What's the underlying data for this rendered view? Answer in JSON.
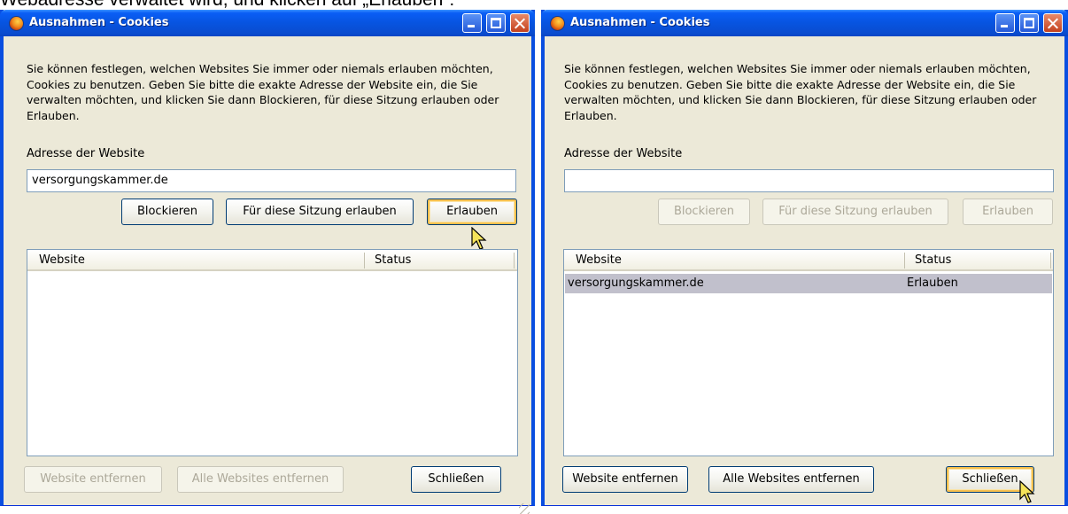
{
  "document": {
    "partial_text": "Webadresse verwaltet wird, und klicken auf „Erlauben“:"
  },
  "dialogs": [
    {
      "title": "Ausnahmen - Cookies",
      "intro": "Sie können festlegen, welchen Websites Sie immer oder niemals erlauben möchten, Cookies zu benutzen. Geben Sie bitte die exakte Adresse der Website ein, die Sie verwalten möchten, und klicken Sie dann Blockieren, für diese Sitzung erlauben oder Erlauben.",
      "address_label": "Adresse der Website",
      "address_value": "versorgungskammer.de",
      "buttons": {
        "block": "Blockieren",
        "session": "Für diese Sitzung erlauben",
        "allow": "Erlauben"
      },
      "columns": {
        "website": "Website",
        "status": "Status"
      },
      "rows": [],
      "footer": {
        "remove": "Website entfernen",
        "remove_all": "Alle Websites entfernen",
        "close": "Schließen"
      }
    },
    {
      "title": "Ausnahmen - Cookies",
      "intro": "Sie können festlegen, welchen Websites Sie immer oder niemals erlauben möchten, Cookies zu benutzen. Geben Sie bitte die exakte Adresse der Website ein, die Sie verwalten möchten, und klicken Sie dann Blockieren, für diese Sitzung erlauben oder Erlauben.",
      "address_label": "Adresse der Website",
      "address_value": "",
      "buttons": {
        "block": "Blockieren",
        "session": "Für diese Sitzung erlauben",
        "allow": "Erlauben"
      },
      "columns": {
        "website": "Website",
        "status": "Status"
      },
      "rows": [
        {
          "website": "versorgungskammer.de",
          "status": "Erlauben"
        }
      ],
      "footer": {
        "remove": "Website entfernen",
        "remove_all": "Alle Websites entfernen",
        "close": "Schließen"
      }
    }
  ],
  "icons": {
    "app": "firefox-icon",
    "minimize": "minimize-icon",
    "maximize": "maximize-icon",
    "close": "close-icon",
    "cursor": "mouse-pointer-icon"
  },
  "colors": {
    "titlebar": "#0754e0",
    "dialog_bg": "#ece9d8",
    "selected_row": "#c1c0cc",
    "button_hot": "#f6c04e"
  }
}
